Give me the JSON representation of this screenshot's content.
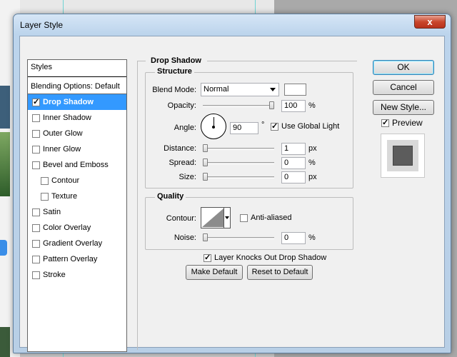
{
  "window": {
    "title": "Layer Style",
    "close_label": "x"
  },
  "styles": {
    "header": "Styles",
    "blending_options": "Blending Options: Default",
    "items": [
      {
        "label": "Drop Shadow",
        "checked": true,
        "selected": true,
        "sub": false
      },
      {
        "label": "Inner Shadow",
        "checked": false,
        "selected": false,
        "sub": false
      },
      {
        "label": "Outer Glow",
        "checked": false,
        "selected": false,
        "sub": false
      },
      {
        "label": "Inner Glow",
        "checked": false,
        "selected": false,
        "sub": false
      },
      {
        "label": "Bevel and Emboss",
        "checked": false,
        "selected": false,
        "sub": false
      },
      {
        "label": "Contour",
        "checked": false,
        "selected": false,
        "sub": true
      },
      {
        "label": "Texture",
        "checked": false,
        "selected": false,
        "sub": true
      },
      {
        "label": "Satin",
        "checked": false,
        "selected": false,
        "sub": false
      },
      {
        "label": "Color Overlay",
        "checked": false,
        "selected": false,
        "sub": false
      },
      {
        "label": "Gradient Overlay",
        "checked": false,
        "selected": false,
        "sub": false
      },
      {
        "label": "Pattern Overlay",
        "checked": false,
        "selected": false,
        "sub": false
      },
      {
        "label": "Stroke",
        "checked": false,
        "selected": false,
        "sub": false
      }
    ]
  },
  "drop_shadow": {
    "title": "Drop Shadow",
    "structure": {
      "title": "Structure",
      "blend_mode_label": "Blend Mode:",
      "blend_mode_value": "Normal",
      "shadow_color": "#ffffff",
      "opacity_label": "Opacity:",
      "opacity_value": "100",
      "opacity_unit": "%",
      "opacity_level": 1.0,
      "angle_label": "Angle:",
      "angle_value": "90",
      "angle_unit": "°",
      "use_global_light_label": "Use Global Light",
      "use_global_light": true,
      "distance_label": "Distance:",
      "distance_value": "1",
      "distance_unit": "px",
      "distance_level": 0.0,
      "spread_label": "Spread:",
      "spread_value": "0",
      "spread_unit": "%",
      "spread_level": 0.0,
      "size_label": "Size:",
      "size_value": "0",
      "size_unit": "px",
      "size_level": 0.0
    },
    "quality": {
      "title": "Quality",
      "contour_label": "Contour:",
      "anti_aliased_label": "Anti-aliased",
      "anti_aliased": false,
      "noise_label": "Noise:",
      "noise_value": "0",
      "noise_unit": "%",
      "noise_level": 0.0
    },
    "knocks_out_label": "Layer Knocks Out Drop Shadow",
    "knocks_out": true,
    "make_default_label": "Make Default",
    "reset_default_label": "Reset to Default"
  },
  "buttons": {
    "ok": "OK",
    "cancel": "Cancel",
    "new_style": "New Style...",
    "preview_label": "Preview",
    "preview_checked": true
  }
}
